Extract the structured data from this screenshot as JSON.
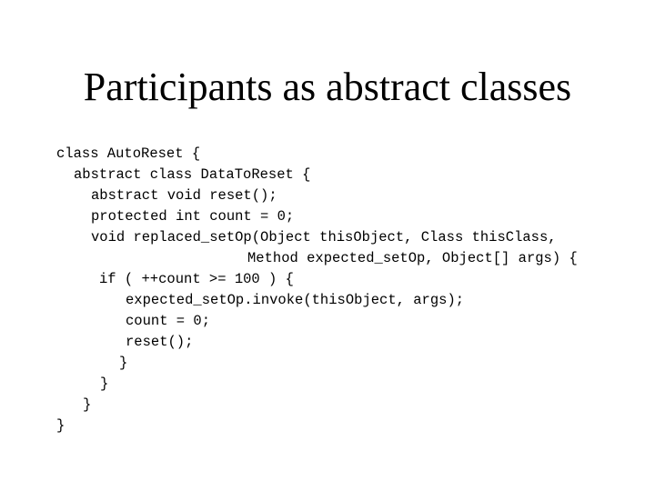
{
  "slide": {
    "title": "Participants as abstract classes",
    "code_lines": [
      "class AutoReset {",
      "abstract class DataToReset {",
      "abstract void reset();",
      "protected int count = 0;",
      "void replaced_setOp(Object thisObject, Class thisClass,",
      "Method expected_setOp, Object[] args) {",
      "if ( ++count >= 100 ) {",
      "expected_setOp.invoke(thisObject, args);",
      "count = 0;",
      "reset();",
      "}",
      "}",
      "}",
      "}"
    ]
  }
}
